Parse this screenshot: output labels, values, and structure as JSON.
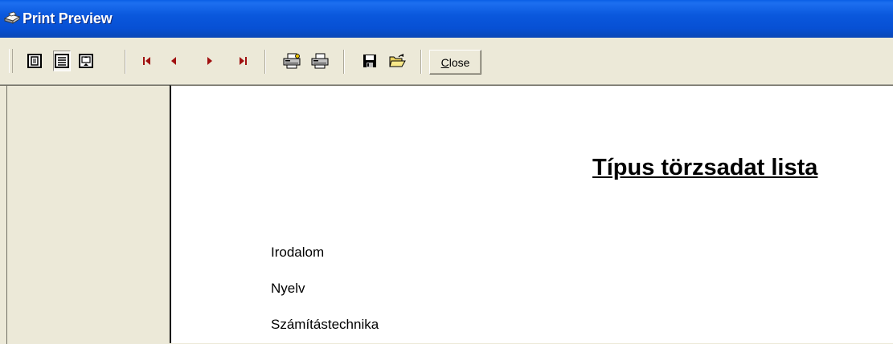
{
  "window": {
    "title": "Print Preview",
    "icon": "print-preview-app-icon"
  },
  "toolbar": {
    "buttons": [
      {
        "name": "one-page-view-button",
        "icon": "one-page-icon"
      },
      {
        "name": "page-width-view-button",
        "icon": "page-width-icon",
        "pressed": true
      },
      {
        "name": "full-page-view-button",
        "icon": "full-page-icon"
      },
      {
        "name": "first-page-button",
        "icon": "first-page-icon"
      },
      {
        "name": "previous-page-button",
        "icon": "previous-page-icon"
      },
      {
        "name": "next-page-button",
        "icon": "next-page-icon"
      },
      {
        "name": "last-page-button",
        "icon": "last-page-icon"
      },
      {
        "name": "print-setup-button",
        "icon": "print-setup-icon"
      },
      {
        "name": "print-button",
        "icon": "printer-icon"
      },
      {
        "name": "save-button",
        "icon": "floppy-disk-icon"
      },
      {
        "name": "open-button",
        "icon": "open-folder-icon"
      }
    ],
    "close_label_mnemonic": "C",
    "close_label_rest": "lose"
  },
  "report": {
    "title": "Típus törzsadat lista",
    "rows": [
      "Irodalom",
      "Nyelv",
      "Számítástechnika"
    ]
  },
  "colors": {
    "titlebar": "#0a58dd",
    "nav_arrow": "#a01010",
    "chrome": "#ece9d8",
    "page": "#ffffff"
  }
}
